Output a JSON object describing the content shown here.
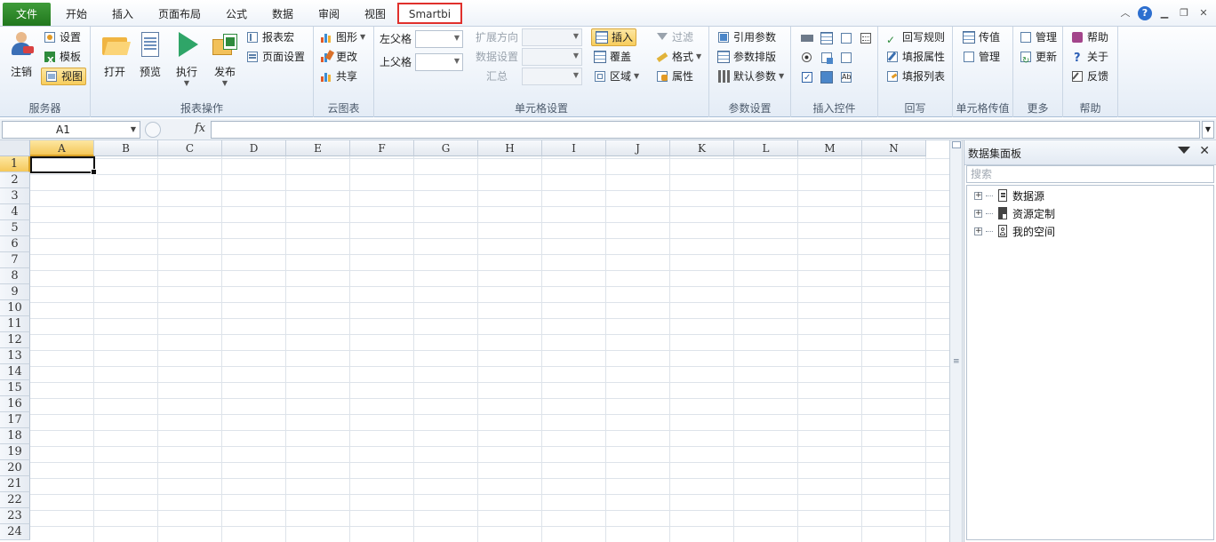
{
  "tabs": [
    {
      "label": "文件"
    },
    {
      "label": "开始"
    },
    {
      "label": "插入"
    },
    {
      "label": "页面布局"
    },
    {
      "label": "公式"
    },
    {
      "label": "数据"
    },
    {
      "label": "审阅"
    },
    {
      "label": "视图"
    },
    {
      "label": "Smartbi"
    }
  ],
  "ribbon": {
    "server": {
      "label": "服务器",
      "logout": "注销",
      "settings": "设置",
      "template": "模板",
      "view": "视图"
    },
    "report_ops": {
      "label": "报表操作",
      "open": "打开",
      "preview": "预览",
      "execute": "执行",
      "publish": "发布",
      "macro": "报表宏",
      "page_setup": "页面设置"
    },
    "cloud_chart": {
      "label": "云图表",
      "chart": "图形",
      "edit": "更改",
      "share": "共享"
    },
    "cell_settings": {
      "label": "单元格设置",
      "left_parent": "左父格",
      "top_parent": "上父格",
      "expand_dir": "扩展方向",
      "data_setting": "数据设置",
      "summary": "汇总",
      "insert": "插入",
      "overwrite": "覆盖",
      "region": "区域",
      "filter": "过滤",
      "format": "格式",
      "property": "属性"
    },
    "params": {
      "label": "参数设置",
      "ref_param": "引用参数",
      "param_layout": "参数排版",
      "default_param": "默认参数"
    },
    "insert_ctrl": {
      "label": "插入控件"
    },
    "writeback": {
      "label": "回写",
      "rules": "回写规则",
      "fill_attr": "填报属性",
      "fill_list": "填报列表"
    },
    "cell_pass": {
      "label": "单元格传值",
      "pass": "传值",
      "manage": "管理"
    },
    "more": {
      "label": "更多",
      "manage": "管理",
      "update": "更新"
    },
    "help": {
      "label": "帮助",
      "help": "帮助",
      "about": "关于",
      "feedback": "反馈"
    }
  },
  "formula_bar": {
    "cell_ref": "A1",
    "fx": "fx",
    "value": ""
  },
  "sheet": {
    "columns": [
      "A",
      "B",
      "C",
      "D",
      "E",
      "F",
      "G",
      "H",
      "I",
      "J",
      "K",
      "L",
      "M",
      "N"
    ],
    "rows": [
      "1",
      "2",
      "3",
      "4",
      "5",
      "6",
      "7",
      "8",
      "9",
      "10",
      "11",
      "12",
      "13",
      "14",
      "15",
      "16",
      "17",
      "18",
      "19",
      "20",
      "21",
      "22",
      "23",
      "24"
    ],
    "selected_cell": "A1"
  },
  "panel": {
    "title": "数据集面板",
    "search_placeholder": "搜索",
    "tree": [
      {
        "label": "数据源"
      },
      {
        "label": "资源定制"
      },
      {
        "label": "我的空间"
      }
    ]
  }
}
